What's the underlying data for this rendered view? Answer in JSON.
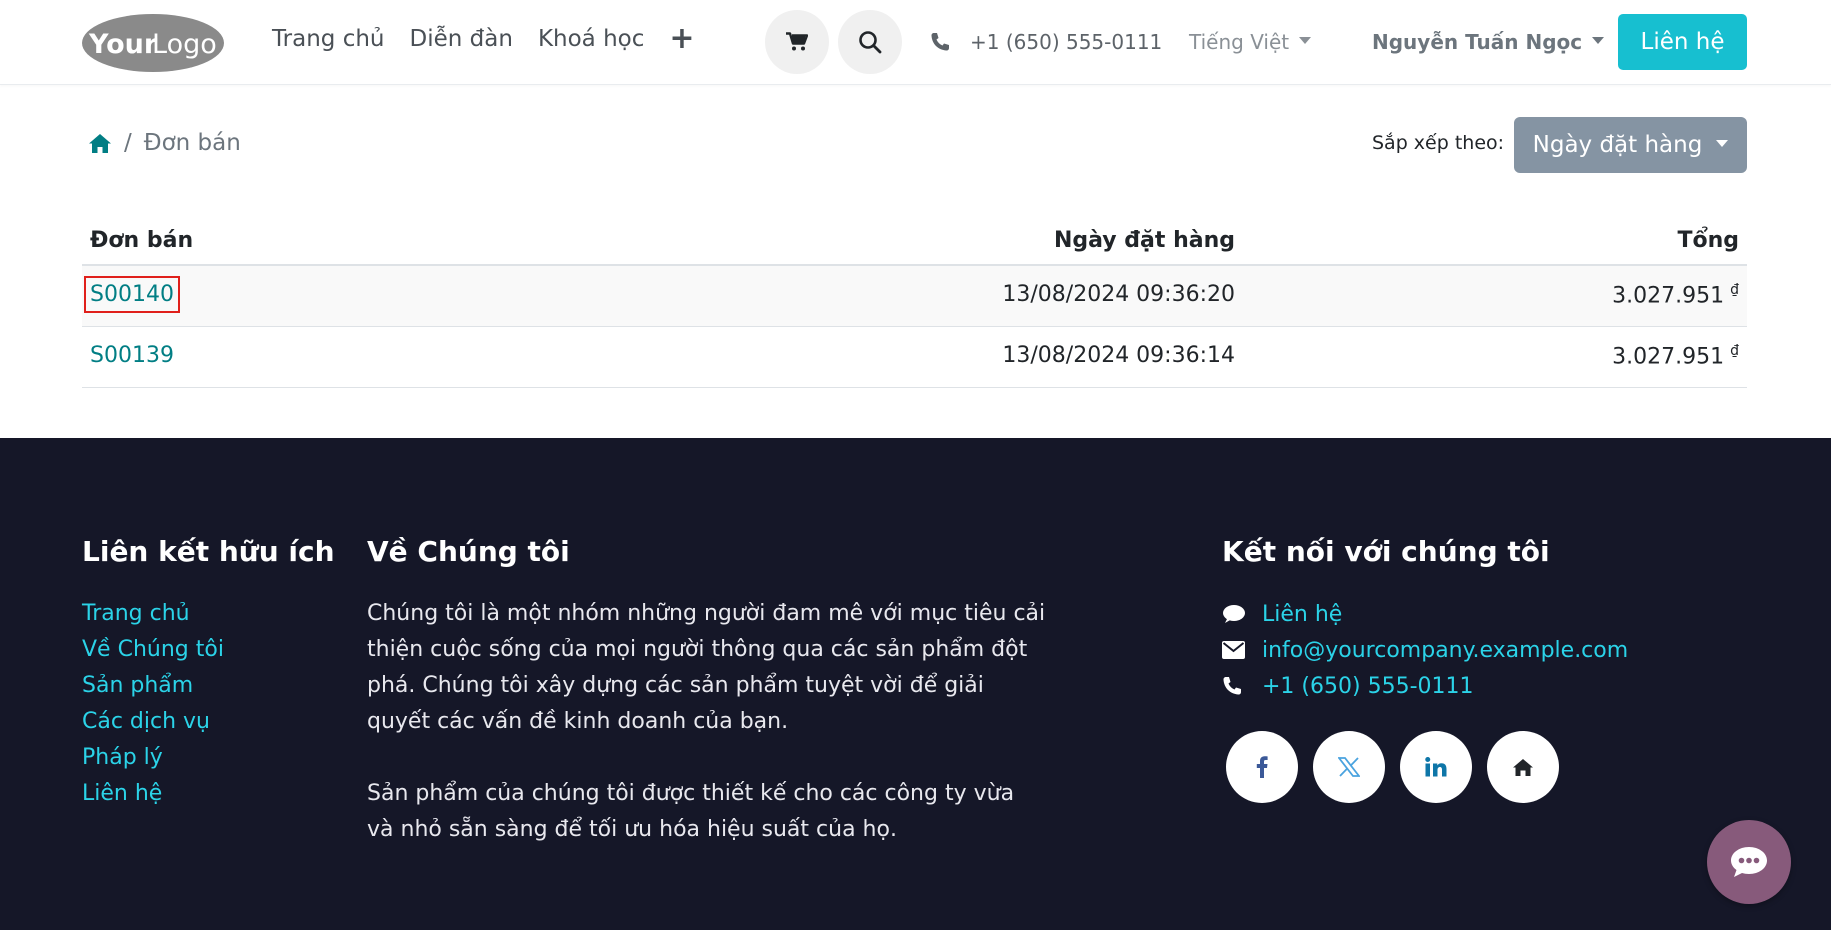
{
  "header": {
    "logo_text_your": "Your",
    "logo_text_logo": "Logo",
    "nav": [
      "Trang chủ",
      "Diễn đàn",
      "Khoá học"
    ],
    "phone": "+1 (650) 555-0111",
    "language": "Tiếng Việt",
    "user": "Nguyễn Tuấn Ngọc",
    "contact_button": "Liên hệ"
  },
  "breadcrumb": {
    "current": "Đơn bán"
  },
  "sort": {
    "label": "Sắp xếp theo:",
    "value": "Ngày đặt hàng"
  },
  "table": {
    "headers": {
      "order": "Đơn bán",
      "date": "Ngày đặt hàng",
      "total": "Tổng"
    },
    "rows": [
      {
        "order": "S00140",
        "date": "13/08/2024  09:36:20",
        "total": "3.027.951",
        "currency": "₫"
      },
      {
        "order": "S00139",
        "date": "13/08/2024  09:36:14",
        "total": "3.027.951",
        "currency": "₫"
      }
    ]
  },
  "footer": {
    "links_title": "Liên kết hữu ích",
    "links": [
      "Trang chủ",
      "Về Chúng tôi",
      "Sản phẩm",
      "Các dịch vụ",
      "Pháp lý",
      "Liên hệ"
    ],
    "about_title": "Về Chúng tôi",
    "about_p1": "Chúng tôi là một nhóm những người đam mê với mục tiêu cải thiện cuộc sống của mọi người thông qua các sản phẩm đột phá. Chúng tôi xây dựng các sản phẩm tuyệt vời để giải quyết các vấn đề kinh doanh của bạn.",
    "about_p2": "Sản phẩm của chúng tôi được thiết kế cho các công ty vừa và nhỏ sẵn sàng để tối ưu hóa hiệu suất của họ.",
    "connect_title": "Kết nối với chúng tôi",
    "contact_link": "Liên hệ",
    "email": "info@yourcompany.example.com",
    "phone": "+1 (650) 555-0111"
  },
  "colors": {
    "accent": "#17bfd0",
    "link": "#017e84",
    "footer_bg": "#151728",
    "footer_link": "#2bd3e8",
    "chat": "#875a7b"
  }
}
